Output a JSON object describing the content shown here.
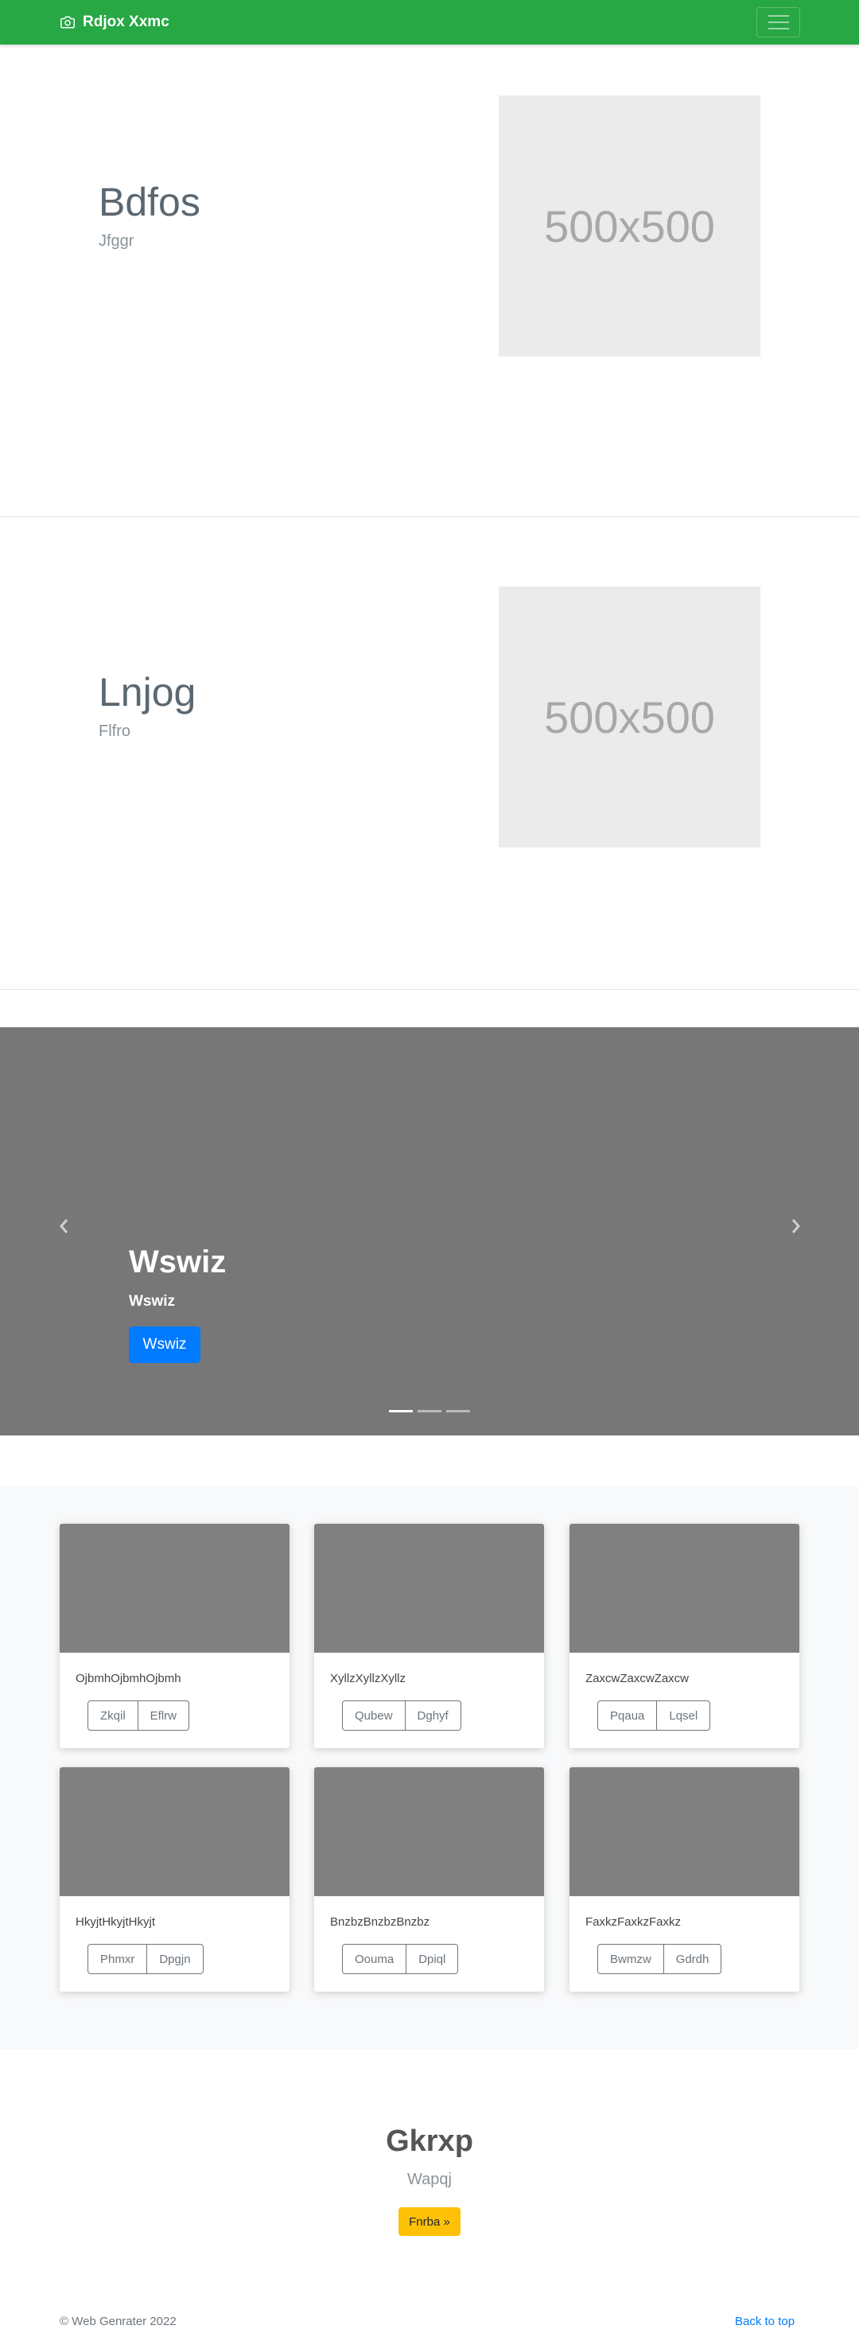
{
  "navbar": {
    "brand": "Rdjox Xxmc",
    "brand_icon": "camera-icon",
    "toggler_icon": "hamburger-icon",
    "color": "#28a745"
  },
  "features": [
    {
      "heading": "Bdfos",
      "sub": "Jfggr",
      "image_label": "500x500"
    },
    {
      "heading": "Lnjog",
      "sub": "Flfro",
      "image_label": "500x500"
    }
  ],
  "carousel": {
    "title": "Wswiz",
    "subtitle": "Wswiz",
    "button": "Wswiz",
    "slide_count": 3,
    "active_slide": 1,
    "prev_icon": "chevron-left-icon",
    "next_icon": "chevron-right-icon",
    "background": "#777777",
    "button_color": "#007bff"
  },
  "album": {
    "cards": [
      {
        "text": "OjbmhOjbmhOjbmh",
        "buttons": [
          "Zkqil",
          "Eflrw"
        ]
      },
      {
        "text": "XyllzXyllzXyllz",
        "buttons": [
          "Qubew",
          "Dghyf"
        ]
      },
      {
        "text": "ZaxcwZaxcwZaxcw",
        "buttons": [
          "Pqaua",
          "Lqsel"
        ]
      },
      {
        "text": "HkyjtHkyjtHkyjt",
        "buttons": [
          "Phmxr",
          "Dpgjn"
        ]
      },
      {
        "text": "BnzbzBnzbzBnzbz",
        "buttons": [
          "Oouma",
          "Dpiql"
        ]
      },
      {
        "text": "FaxkzFaxkzFaxkz",
        "buttons": [
          "Bwmzw",
          "Gdrdh"
        ]
      }
    ]
  },
  "jumbo": {
    "title": "Gkrxp",
    "subtitle": "Wapqj",
    "button": "Fnrba »",
    "button_color": "#ffc107"
  },
  "footer": {
    "copyright": "© Web Genrater 2022",
    "back_to_top": "Back to top"
  }
}
